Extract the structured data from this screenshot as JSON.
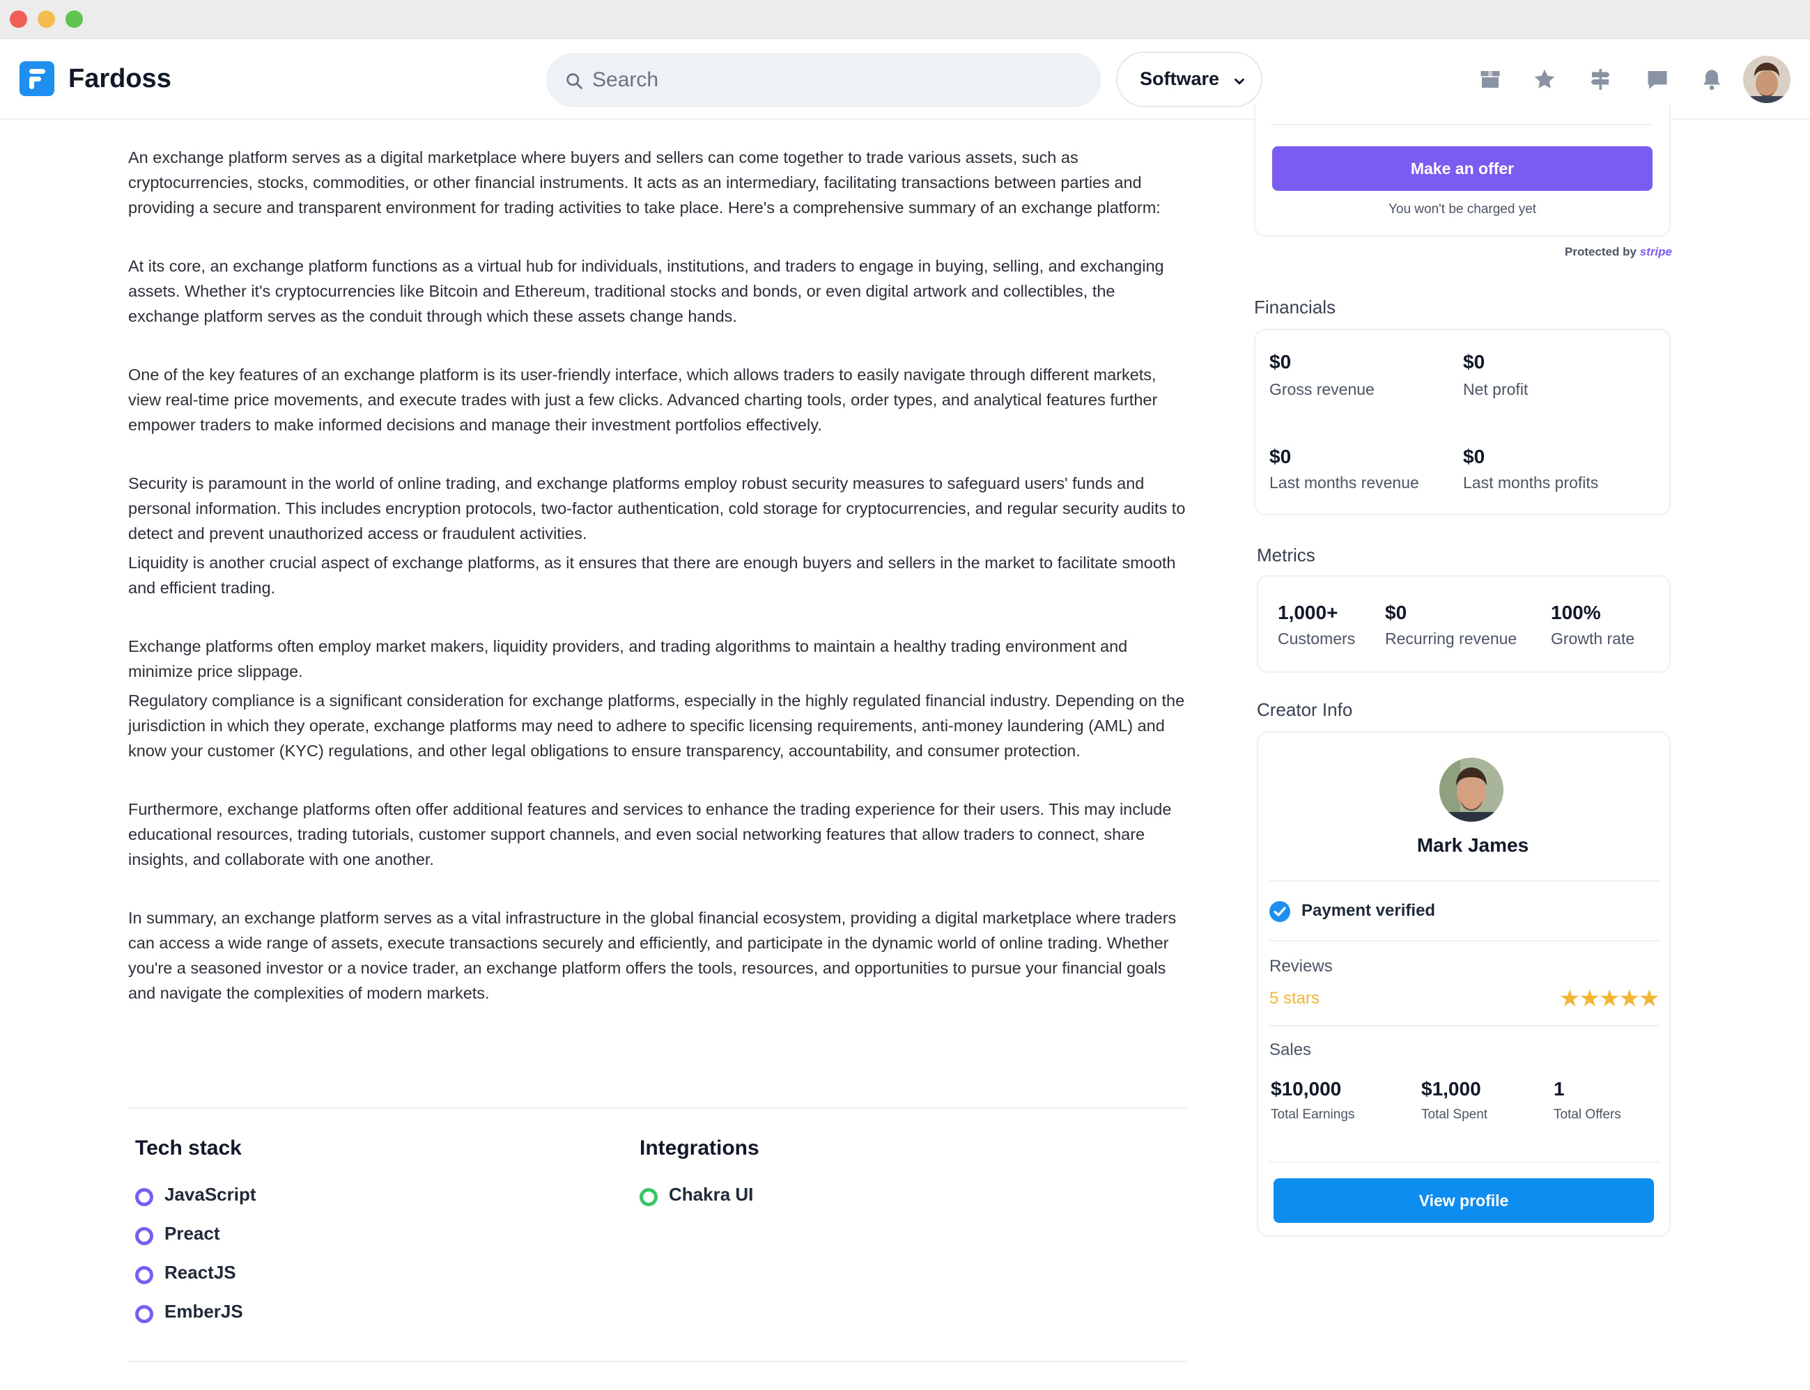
{
  "app": {
    "name": "Fardoss"
  },
  "search": {
    "placeholder": "Search"
  },
  "category": {
    "selected": "Software"
  },
  "nav_icons": [
    "box-icon",
    "star-icon",
    "signpost-icon",
    "chat-icon",
    "bell-icon"
  ],
  "article": {
    "paragraphs": [
      "An exchange platform serves as a digital marketplace where buyers and sellers can come together to trade various assets, such as cryptocurrencies, stocks, commodities, or other financial instruments. It acts as an intermediary, facilitating transactions between parties and providing a secure and transparent environment for trading activities to take place. Here's a comprehensive summary of an exchange platform:",
      "At its core, an exchange platform functions as a virtual hub for individuals, institutions, and traders to engage in buying, selling, and exchanging assets. Whether it's cryptocurrencies like Bitcoin and Ethereum, traditional stocks and bonds, or even digital artwork and collectibles, the exchange platform serves as the conduit through which these assets change hands.",
      "One of the key features of an exchange platform is its user-friendly interface, which allows traders to easily navigate through different markets, view real-time price movements, and execute trades with just a few clicks. Advanced charting tools, order types, and analytical features further empower traders to make informed decisions and manage their investment portfolios effectively.",
      "Security is paramount in the world of online trading, and exchange platforms employ robust security measures to safeguard users' funds and personal information. This includes encryption protocols, two-factor authentication, cold storage for cryptocurrencies, and regular security audits to detect and prevent unauthorized access or fraudulent activities.",
      "Liquidity is another crucial aspect of exchange platforms, as it ensures that there are enough buyers and sellers in the market to facilitate smooth and efficient trading.",
      "Exchange platforms often employ market makers, liquidity providers, and trading algorithms to maintain a healthy trading environment and minimize price slippage.",
      "Regulatory compliance is a significant consideration for exchange platforms, especially in the highly regulated financial industry. Depending on the jurisdiction in which they operate, exchange platforms may need to adhere to specific licensing requirements, anti-money laundering (AML) and know your customer (KYC) regulations, and other legal obligations to ensure transparency, accountability, and consumer protection.",
      "Furthermore, exchange platforms often offer additional features and services to enhance the trading experience for their users. This may include educational resources, trading tutorials, customer support channels, and even social networking features that allow traders to connect, share insights, and collaborate with one another.",
      "In summary, an exchange platform serves as a vital infrastructure in the global financial ecosystem, providing a digital marketplace where traders can access a wide range of assets, execute transactions securely and efficiently, and participate in the dynamic world of online trading. Whether you're a seasoned investor or a novice trader, an exchange platform offers the tools, resources, and opportunities to pursue your financial goals and navigate the complexities of modern markets."
    ]
  },
  "tech_stack": {
    "title": "Tech stack",
    "items": [
      "JavaScript",
      "Preact",
      "ReactJS",
      "EmberJS"
    ]
  },
  "integrations": {
    "title": "Integrations",
    "items": [
      "Chakra UI"
    ]
  },
  "offer": {
    "button": "Make an offer",
    "note": "You won't be charged yet",
    "protected_by": "Protected by",
    "provider": "stripe"
  },
  "financials": {
    "title": "Financials",
    "items": [
      {
        "value": "$0",
        "label": "Gross revenue"
      },
      {
        "value": "$0",
        "label": "Net profit"
      },
      {
        "value": "$0",
        "label": "Last months revenue"
      },
      {
        "value": "$0",
        "label": "Last months profits"
      }
    ]
  },
  "metrics": {
    "title": "Metrics",
    "items": [
      {
        "value": "1,000+",
        "label": "Customers"
      },
      {
        "value": "$0",
        "label": "Recurring revenue"
      },
      {
        "value": "100%",
        "label": "Growth rate"
      }
    ]
  },
  "creator": {
    "title": "Creator Info",
    "name": "Mark James",
    "verified": "Payment verified",
    "reviews_label": "Reviews",
    "stars_label": "5 stars",
    "rating": 5,
    "sales_label": "Sales",
    "sales": [
      {
        "value": "$10,000",
        "label": "Total Earnings"
      },
      {
        "value": "$1,000",
        "label": "Total Spent"
      },
      {
        "value": "1",
        "label": "Total Offers"
      }
    ],
    "button": "View profile"
  },
  "colors": {
    "brand": "#1e8ff0",
    "accent": "#7b5cf0",
    "star": "#f2b634",
    "integration": "#3cc46a"
  }
}
